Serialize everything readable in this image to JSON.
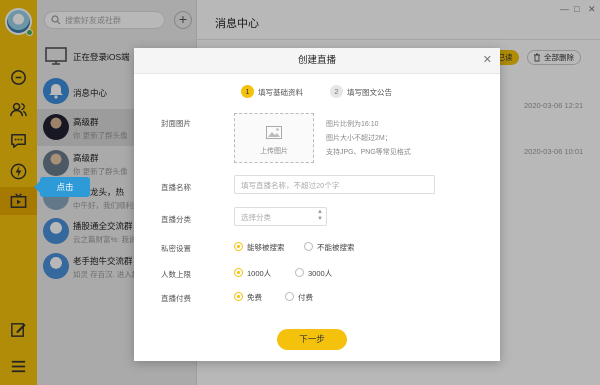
{
  "colors": {
    "accent": "#f4c20d",
    "rail": "#f4c20d",
    "tooltip": "#2e9ad8"
  },
  "rail": {
    "icons": [
      "message-icon",
      "contacts-icon",
      "chat-bubble-icon",
      "lightning-icon",
      "live-tv-icon",
      "edit-icon",
      "menu-icon"
    ]
  },
  "sidebar": {
    "search_placeholder": "搜索好友或社群",
    "add_label": "+",
    "items": [
      {
        "name": "正在登录iOS端",
        "sub": ""
      },
      {
        "name": "消息中心",
        "sub": ""
      },
      {
        "name": "高级群",
        "sub": "你 更新了群头像"
      },
      {
        "name": "高级群",
        "sub": "你 更新了群头像"
      },
      {
        "name": "市场龙头，热",
        "sub": "中午好，我们顺利好"
      },
      {
        "name": "播股通全交流群",
        "sub": "云之篇财富%: 我说说"
      },
      {
        "name": "老手抱牛交流群",
        "sub": "如灵 存百汉. 进入群聊"
      }
    ],
    "tooltip": "点击"
  },
  "main": {
    "title": "消息中心",
    "window_controls": [
      "—",
      "□",
      "✕"
    ],
    "mark_read": "部已读",
    "delete_all": "全部删除",
    "timestamps": [
      "2020-03-06 12:21",
      "2020-03-06 10:01"
    ]
  },
  "modal": {
    "title": "创建直播",
    "close": "✕",
    "steps": [
      {
        "num": "1",
        "label": "填写基础资料"
      },
      {
        "num": "2",
        "label": "填写图文公告"
      }
    ],
    "cover": {
      "label": "封面图片",
      "upload": "上传图片",
      "hints": [
        "图片比例为16:10",
        "图片大小不超过2M；",
        "支持JPG、PNG等常见格式"
      ]
    },
    "live_name": {
      "label": "直播名称",
      "placeholder": "填写直播名称，不超过20个字"
    },
    "field3": {
      "label": "直播分类",
      "placeholder": "选择分类"
    },
    "privacy": {
      "label": "私密设置",
      "options": [
        "能够被搜索",
        "不能被搜索"
      ],
      "selected": 0
    },
    "capacity": {
      "label": "人数上限",
      "options": [
        "1000人",
        "3000人"
      ],
      "selected": 0
    },
    "fee": {
      "label": "直播付费",
      "options": [
        "免费",
        "付费"
      ],
      "selected": 0
    },
    "next": "下一步"
  }
}
